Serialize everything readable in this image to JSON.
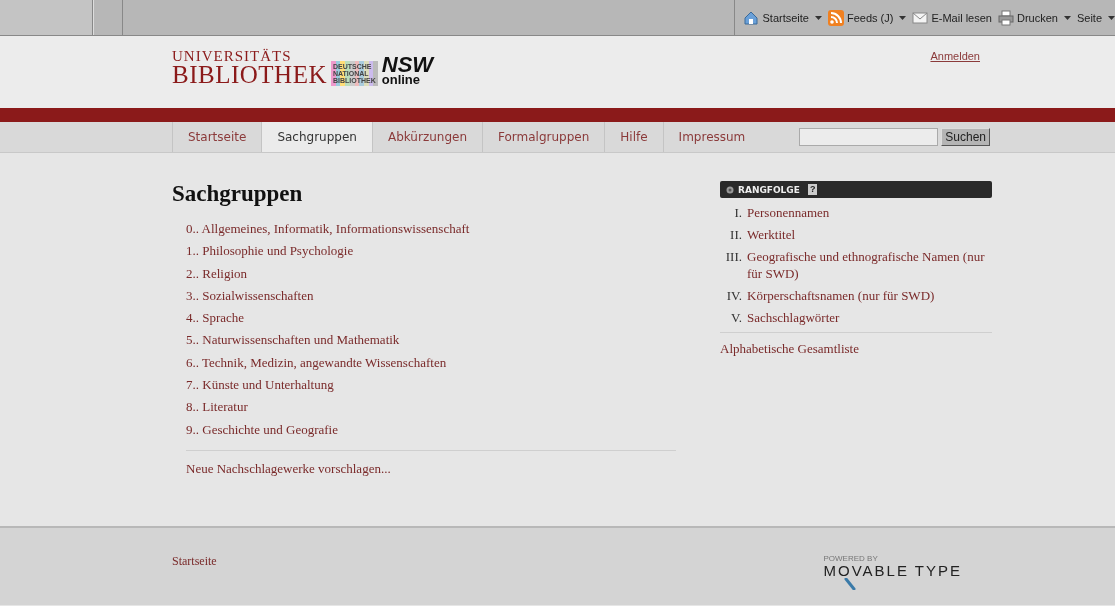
{
  "browser_toolbar": {
    "buttons": [
      {
        "kind": "home",
        "label": "Startseite",
        "has_menu": true
      },
      {
        "kind": "feed",
        "label": "Feeds (J)",
        "has_menu": true
      },
      {
        "kind": "mail",
        "label": "E-Mail lesen",
        "has_menu": false
      },
      {
        "kind": "print",
        "label": "Drucken",
        "has_menu": true
      },
      {
        "kind": "page",
        "label": "Seite",
        "has_menu": true
      }
    ]
  },
  "header": {
    "logo": {
      "line_1": "UNIVERSITÄTS",
      "line_2": "BIBLIOTHEK",
      "dnb_lines": [
        "DEUTSCHE",
        "NATIONAL",
        "BIBLIOTHEK"
      ],
      "nsw": "NSW",
      "online": "online"
    },
    "login_link": "Anmelden"
  },
  "nav": {
    "tabs": [
      {
        "label": "Startseite",
        "selected": false
      },
      {
        "label": "Sachgruppen",
        "selected": true
      },
      {
        "label": "Abkürzungen",
        "selected": false
      },
      {
        "label": "Formalgruppen",
        "selected": false
      },
      {
        "label": "Hilfe",
        "selected": false
      },
      {
        "label": "Impressum",
        "selected": false
      }
    ],
    "search": {
      "button": "Suchen"
    }
  },
  "main": {
    "title": "Sachgruppen",
    "categories": [
      "0.. Allgemeines, Informatik, Informationswissenschaft",
      "1.. Philosophie und Psychologie",
      "2.. Religion",
      "3.. Sozialwissenschaften",
      "4.. Sprache",
      "5.. Naturwissenschaften und Mathematik",
      "6.. Technik, Medizin, angewandte Wissenschaften",
      "7.. Künste und Unterhaltung",
      "8.. Literatur",
      "9.. Geschichte und Geografie"
    ],
    "suggest_link": "Neue Nachschlagewerke vorschlagen..."
  },
  "sidebar": {
    "heading": "RANGFOLGE",
    "help": "?",
    "items": [
      {
        "numeral": "I.",
        "label": "Personennamen"
      },
      {
        "numeral": "II.",
        "label": "Werktitel"
      },
      {
        "numeral": "III.",
        "label": "Geografische und ethnografische Namen (nur für SWD)"
      },
      {
        "numeral": "IV.",
        "label": "Körperschaftsnamen (nur für SWD)"
      },
      {
        "numeral": "V.",
        "label": "Sachschlagwörter"
      }
    ],
    "all_link": "Alphabetische Gesamtliste"
  },
  "footer": {
    "link": "Startseite",
    "powered_by": "POWERED BY",
    "brand": "MOVABLE TYPE"
  }
}
